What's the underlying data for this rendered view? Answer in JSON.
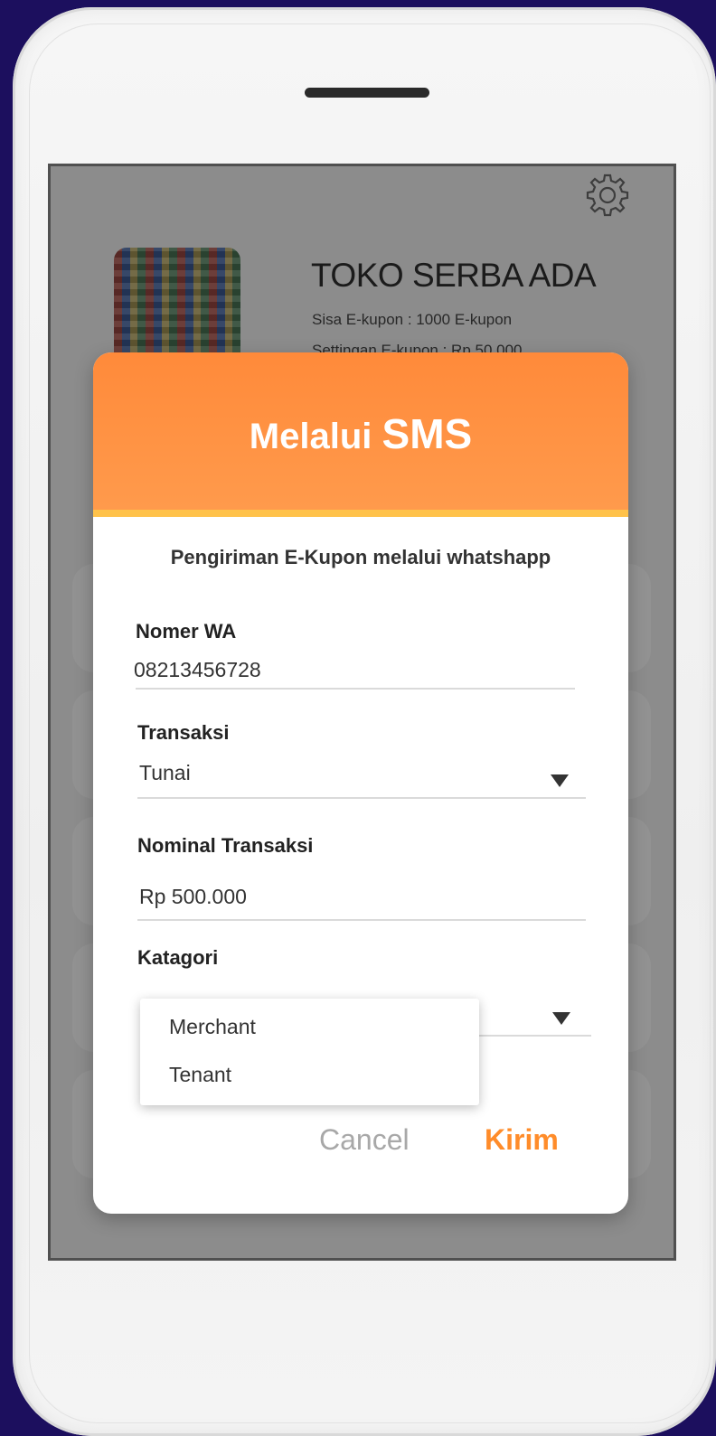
{
  "store": {
    "name": "TOKO SERBA ADA",
    "remaining": "Sisa E-kupon : 1000 E-kupon",
    "setting": "Settingan E-kupon : Rp 50.000"
  },
  "dialog": {
    "title_prefix": "Melalui",
    "title_main": "SMS",
    "subtitle": "Pengiriman E-Kupon melalui whatshapp",
    "wa_label": "Nomer WA",
    "wa_value": "08213456728",
    "transaksi_label": "Transaksi",
    "transaksi_value": "Tunai",
    "nominal_label": "Nominal Transaksi",
    "nominal_value": "Rp 500.000",
    "kategori_label": "Katagori",
    "kategori_options": [
      "Merchant",
      "Tenant"
    ],
    "cancel_label": "Cancel",
    "send_label": "Kirim"
  },
  "colors": {
    "accent": "#ff8c2a",
    "header": "#ff9045",
    "header_border": "#ffc24a",
    "background": "#1c0f5e"
  },
  "icons": {
    "settings": "gear-icon",
    "dropdown": "triangle-down-icon"
  }
}
